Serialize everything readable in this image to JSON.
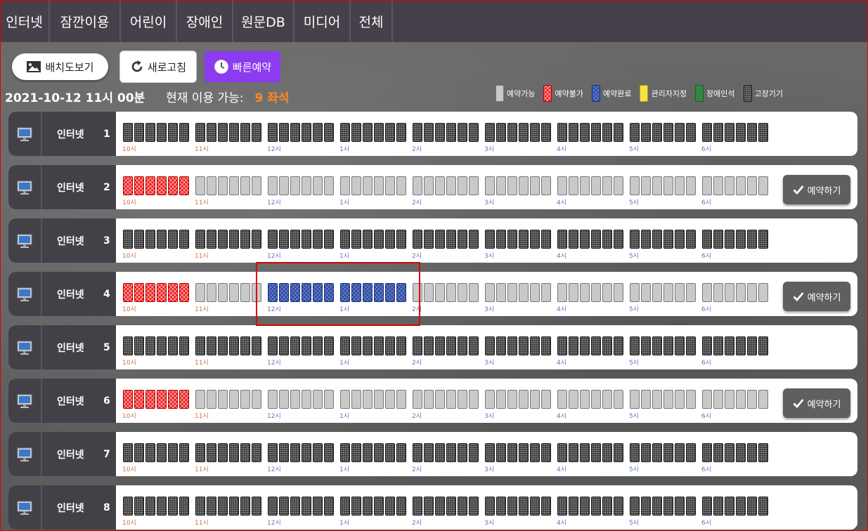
{
  "nav": {
    "tabs": [
      {
        "label": "인터넷"
      },
      {
        "label": "잠깐이용"
      },
      {
        "label": "어린이"
      },
      {
        "label": "장애인"
      },
      {
        "label": "원문DB"
      },
      {
        "label": "미디어"
      },
      {
        "label": "전체"
      }
    ]
  },
  "toolbar": {
    "layout_label": "배치도보기",
    "refresh_label": "새로고침",
    "quick_label": "빠른예약"
  },
  "status": {
    "datetime": "2021-10-12 11시 00분",
    "available_label": "현재 이용 가능:",
    "available_count": "9 좌석"
  },
  "legend": [
    {
      "label": "예약가능",
      "state": "avail"
    },
    {
      "label": "예약불가",
      "state": "unavail"
    },
    {
      "label": "예약완료",
      "state": "done"
    },
    {
      "label": "관리자지정",
      "state": "admin"
    },
    {
      "label": "장애인석",
      "state": "disabled"
    },
    {
      "label": "고장기기",
      "state": "broken"
    }
  ],
  "hours": [
    "10시",
    "11시",
    "12시",
    "1시",
    "2시",
    "3시",
    "4시",
    "5시",
    "6시"
  ],
  "reserve_label": "예약하기",
  "rows": [
    {
      "name": "인터넷",
      "number": "1",
      "pattern": [
        [
          "broken",
          54
        ]
      ],
      "reservable": false
    },
    {
      "name": "인터넷",
      "number": "2",
      "pattern": [
        [
          "unavail",
          6
        ],
        [
          "avail",
          48
        ]
      ],
      "reservable": true
    },
    {
      "name": "인터넷",
      "number": "3",
      "pattern": [
        [
          "broken",
          54
        ]
      ],
      "reservable": false
    },
    {
      "name": "인터넷",
      "number": "4",
      "pattern": [
        [
          "unavail",
          6
        ],
        [
          "avail",
          6
        ],
        [
          "done",
          12
        ],
        [
          "avail",
          30
        ]
      ],
      "reservable": true
    },
    {
      "name": "인터넷",
      "number": "5",
      "pattern": [
        [
          "broken",
          54
        ]
      ],
      "reservable": false
    },
    {
      "name": "인터넷",
      "number": "6",
      "pattern": [
        [
          "unavail",
          6
        ],
        [
          "avail",
          48
        ]
      ],
      "reservable": true
    },
    {
      "name": "인터넷",
      "number": "7",
      "pattern": [
        [
          "broken",
          54
        ]
      ],
      "reservable": false
    },
    {
      "name": "인터넷",
      "number": "8",
      "pattern": [
        [
          "broken",
          54
        ]
      ],
      "reservable": false
    }
  ]
}
